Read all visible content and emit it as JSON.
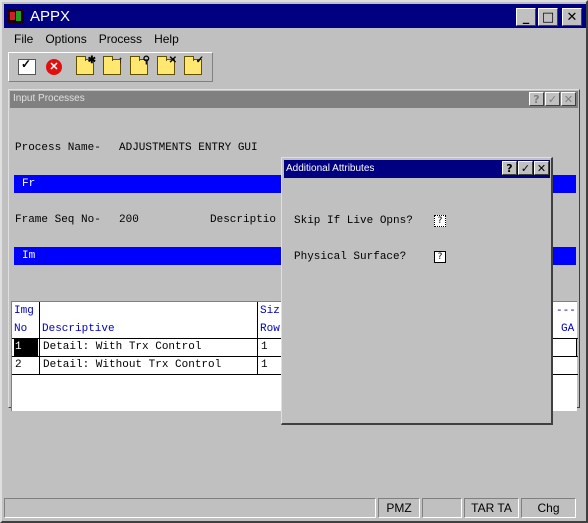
{
  "app": {
    "title": "APPX"
  },
  "menu": [
    "File",
    "Options",
    "Process",
    "Help"
  ],
  "toolbar": {
    "icons": [
      "checkmark-doc-icon",
      "stop-icon",
      "new-folder-icon",
      "open-folder-icon",
      "search-folder-icon",
      "delete-folder-icon",
      "close-folder-icon"
    ]
  },
  "mdi": {
    "title": "Input Processes",
    "process_label": "Process Name-",
    "process_value": "ADJUSTMENTS ENTRY GUI",
    "frame_bar": "Fr",
    "frame_seq_label": "Frame Seq No-",
    "frame_seq_value": "200",
    "description_label": "Descriptio",
    "image_bar": "Im",
    "grid": {
      "headers": {
        "img": "Img",
        "no": "No",
        "descriptive": "Descriptive",
        "siz": "Siz",
        "row": "Row",
        "dashes": "---",
        "ga": "GA"
      },
      "rows": [
        {
          "no": "1",
          "descriptive": "Detail: With Trx Control",
          "row": "1"
        },
        {
          "no": "2",
          "descriptive": "Detail: Without Trx Control",
          "row": "1"
        }
      ]
    }
  },
  "dialog": {
    "title": "Additional Attributes",
    "fields": [
      {
        "label": "Skip If Live Opns?",
        "value": "?"
      },
      {
        "label": "Physical Surface?",
        "value": "?"
      }
    ]
  },
  "status": {
    "pmz": "PMZ",
    "tar": "TAR TA",
    "mode": "Chg"
  }
}
